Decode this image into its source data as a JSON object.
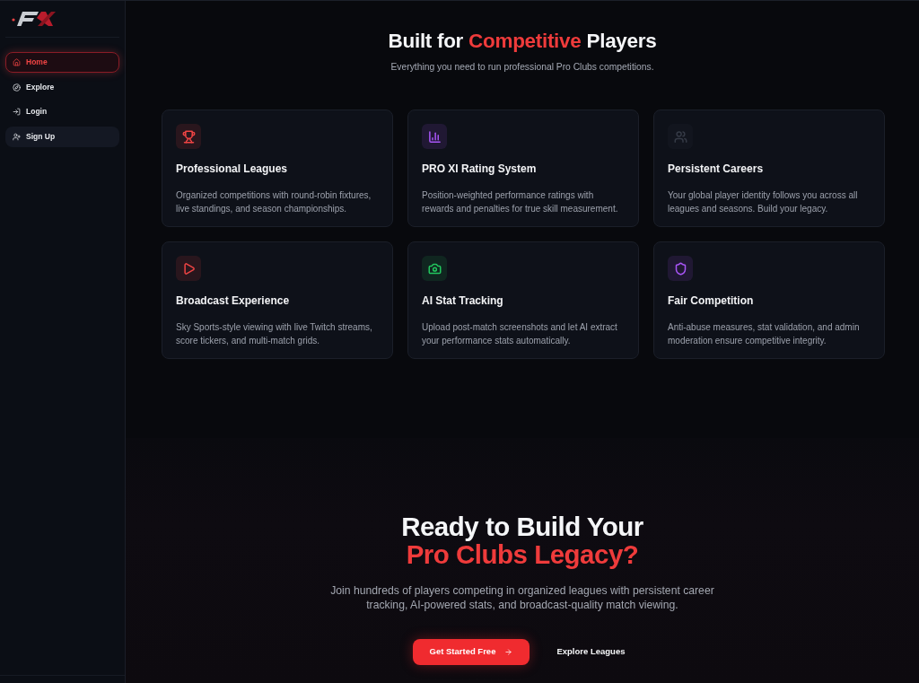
{
  "sidebar": {
    "nav_items": [
      {
        "label": "Home",
        "selected": true,
        "hovered": false
      },
      {
        "label": "Explore",
        "selected": false,
        "hovered": false
      },
      {
        "label": "Login",
        "selected": false,
        "hovered": false
      },
      {
        "label": "Sign Up",
        "selected": false,
        "hovered": true
      }
    ]
  },
  "features_section": {
    "title": [
      {
        "text": "Built for ",
        "accent": false
      },
      {
        "text": "Competitive",
        "accent": true
      },
      {
        "text": " Players",
        "accent": false
      }
    ],
    "subtitle": "Everything you need to run professional Pro Clubs competitions.",
    "features": [
      {
        "color": "#ef4444",
        "title": "Professional Leagues",
        "description": "Organized competitions with round-robin fixtures, live standings, and season championships."
      },
      {
        "color": "#a855f7",
        "title": "PRO XI Rating System",
        "description": "Position-weighted performance ratings with rewards and penalties for true skill measurement."
      },
      {
        "color": "#353a46",
        "title": "Persistent Careers",
        "description": "Your global player identity follows you across all leagues and seasons. Build your legacy."
      },
      {
        "color": "#ef4444",
        "title": "Broadcast Experience",
        "description": "Sky Sports-style viewing with live Twitch streams, score tickers, and multi-match grids."
      },
      {
        "color": "#22c55e",
        "title": "AI Stat Tracking",
        "description": "Upload post-match screenshots and let AI extract your performance stats automatically."
      },
      {
        "color": "#a855f7",
        "title": "Fair Competition",
        "description": "Anti-abuse measures, stat validation, and admin moderation ensure competitive integrity."
      }
    ]
  },
  "cta_section": {
    "title": [
      {
        "text": "Ready to Build Your",
        "accent": false
      },
      {
        "text": "Pro Clubs Legacy?",
        "accent": true
      }
    ],
    "description": "Join hundreds of players competing in organized leagues with persistent career tracking, AI-powered stats, and broadcast-quality match viewing.",
    "primary_button": "Get Started Free",
    "secondary_button": "Explore Leagues"
  }
}
